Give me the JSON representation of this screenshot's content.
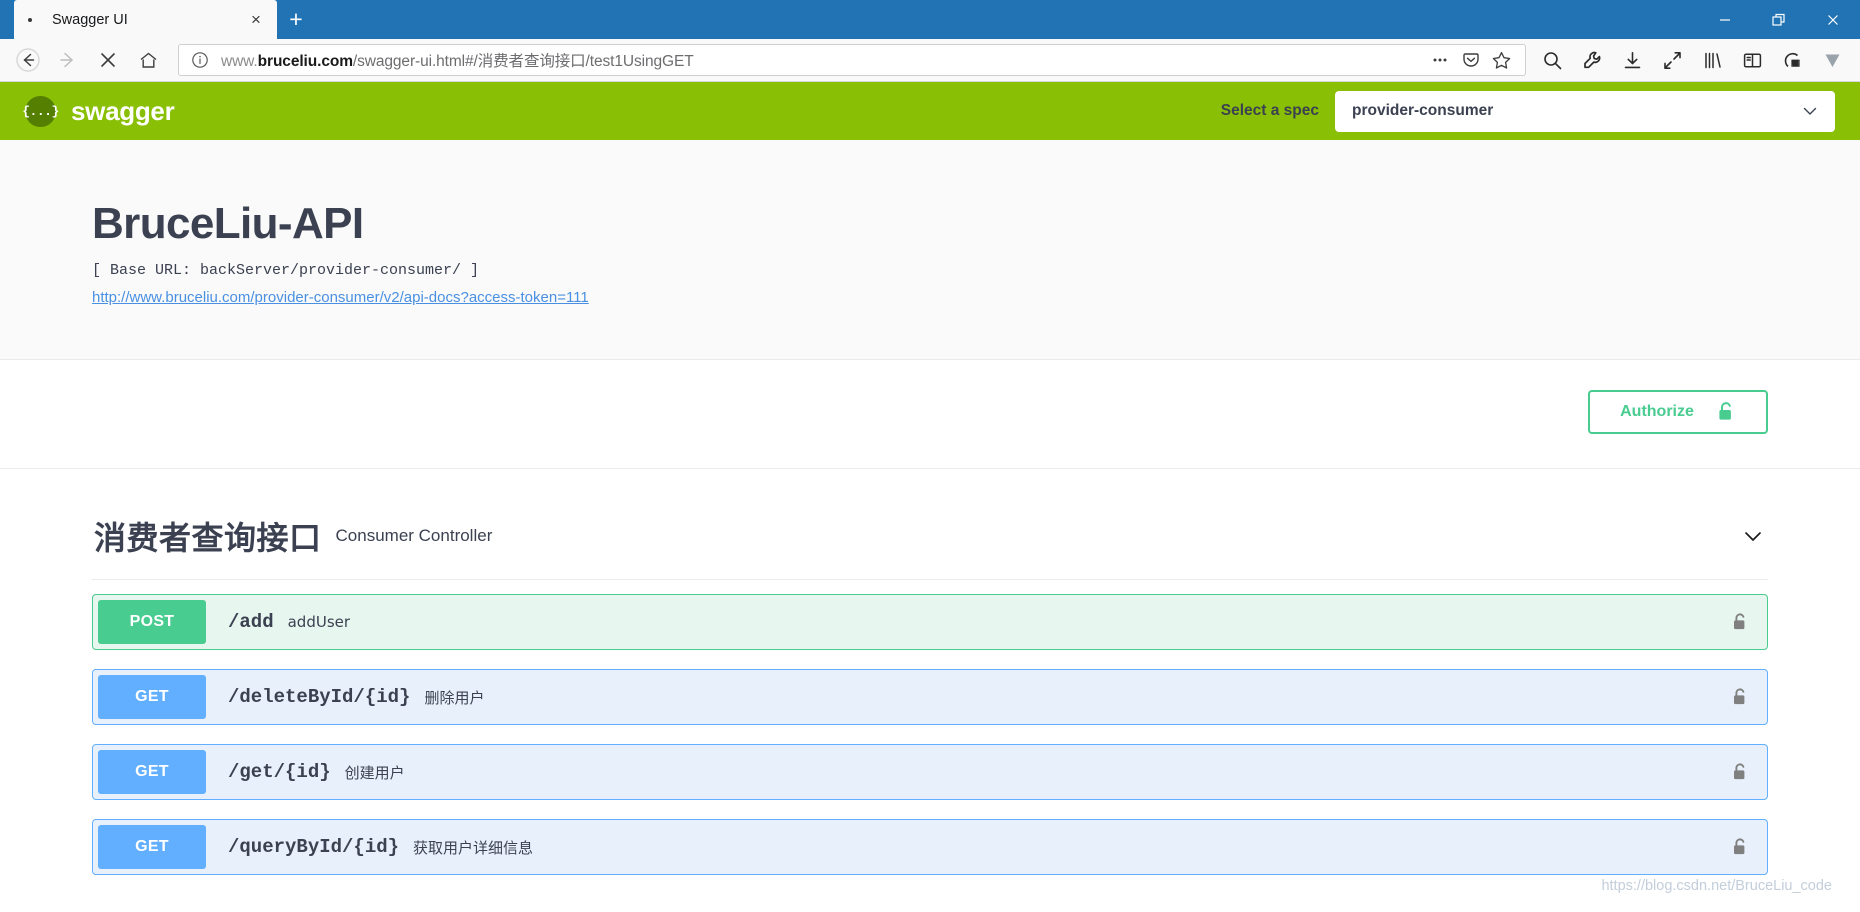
{
  "browser": {
    "tab": {
      "title": "Swagger UI",
      "close_label": "×"
    },
    "new_tab_label": "+",
    "window_controls": {
      "minimize": "minimize-icon",
      "restore": "restore-icon",
      "close": "close-icon"
    },
    "nav": {
      "back": "back-arrow-icon",
      "forward": "forward-arrow-icon",
      "stop": "stop-icon",
      "home": "home-icon"
    },
    "address": {
      "info_icon": "info-circle-icon",
      "host_prefix": "www.",
      "host": "bruceliu.com",
      "path": "/swagger-ui.html#/消费者查询接口/test1UsingGET",
      "full_url": "www.bruceliu.com/swagger-ui.html#/消费者查询接口/test1UsingGET",
      "page_actions": [
        "ellipsis-icon",
        "pocket-icon",
        "bookmark-star-icon"
      ]
    },
    "toolbar_icons": [
      "search-icon",
      "wrench-icon",
      "download-icon",
      "expand-icon",
      "library-icon",
      "sidebar-icon",
      "account-icon",
      "chevron-v-icon"
    ]
  },
  "swagger": {
    "logo_text": "swagger",
    "logo_mark": "{...}",
    "spec_label": "Select a spec",
    "spec_selected": "provider-consumer",
    "spec_caret": "chevron-down-icon"
  },
  "info": {
    "title": "BruceLiu-API",
    "base_url": "[ Base URL: backServer/provider-consumer/ ]",
    "docs_link": "http://www.bruceliu.com/provider-consumer/v2/api-docs?access-token=111"
  },
  "auth": {
    "button_label": "Authorize",
    "lock_icon": "unlock-icon"
  },
  "tag": {
    "title": "消费者查询接口",
    "description": "Consumer Controller",
    "caret": "chevron-down-icon"
  },
  "operations": [
    {
      "method": "POST",
      "method_class": "post",
      "path": "/add",
      "summary": "addUser",
      "lock": "unlock-icon"
    },
    {
      "method": "GET",
      "method_class": "get",
      "path": "/deleteById/{id}",
      "summary": "删除用户",
      "lock": "unlock-icon"
    },
    {
      "method": "GET",
      "method_class": "get",
      "path": "/get/{id}",
      "summary": "创建用户",
      "lock": "unlock-icon"
    },
    {
      "method": "GET",
      "method_class": "get",
      "path": "/queryById/{id}",
      "summary": "获取用户详细信息",
      "lock": "unlock-icon"
    }
  ],
  "watermark": "https://blog.csdn.net/BruceLiu_code",
  "colors": {
    "titlebar": "#2173b3",
    "swagger_green": "#89bf04",
    "post_green": "#49cc90",
    "get_blue": "#61affe",
    "text": "#3b4151"
  }
}
